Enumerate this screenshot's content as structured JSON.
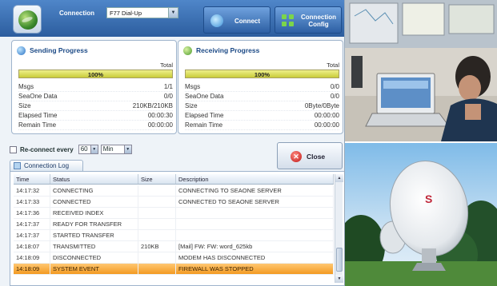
{
  "connection": {
    "label": "Connection",
    "selected": "F77 Dial-Up",
    "connect_label": "Connect",
    "config_label": "Connection Config"
  },
  "sending": {
    "title": "Sending Progress",
    "total_label": "Total",
    "percent": "100%",
    "fraction": 1.0,
    "rows": [
      {
        "label": "Msgs",
        "value": "1/1"
      },
      {
        "label": "SeaOne Data",
        "value": "0/0"
      },
      {
        "label": "Size",
        "value": "210KB/210KB"
      },
      {
        "label": "Elapsed Time",
        "value": "00:00:30"
      },
      {
        "label": "Remain Time",
        "value": "00:00:00"
      }
    ]
  },
  "receiving": {
    "title": "Receiving Progress",
    "total_label": "Total",
    "percent": "100%",
    "fraction": 1.0,
    "rows": [
      {
        "label": "Msgs",
        "value": "0/0"
      },
      {
        "label": "SeaOne Data",
        "value": "0/0"
      },
      {
        "label": "Size",
        "value": "0Byte/0Byte"
      },
      {
        "label": "Elapsed Time",
        "value": "00:00:00"
      },
      {
        "label": "Remain Time",
        "value": "00:00:00"
      }
    ]
  },
  "reconnect": {
    "label": "Re-connect every",
    "interval": "60",
    "unit": "Min"
  },
  "close_label": "Close",
  "log": {
    "tab_label": "Connection Log",
    "columns": [
      "Time",
      "Status",
      "Size",
      "Description"
    ],
    "rows": [
      {
        "time": "14:17:32",
        "status": "CONNECTING",
        "size": "",
        "description": "CONNECTING TO SEAONE SERVER"
      },
      {
        "time": "14:17:33",
        "status": "CONNECTED",
        "size": "",
        "description": "CONNECTED TO SEAONE SERVER"
      },
      {
        "time": "14:17:36",
        "status": "RECEIVED INDEX",
        "size": "",
        "description": ""
      },
      {
        "time": "14:17:37",
        "status": "READY FOR TRANSFER",
        "size": "",
        "description": ""
      },
      {
        "time": "14:17:37",
        "status": "STARTED TRANSFER",
        "size": "",
        "description": ""
      },
      {
        "time": "14:18:07",
        "status": "TRANSMITTED",
        "size": "210KB",
        "description": "[Mail] FW: FW: word_625kb"
      },
      {
        "time": "14:18:09",
        "status": "DISCONNECTED",
        "size": "",
        "description": "MODEM HAS DISCONNECTED"
      },
      {
        "time": "14:18:09",
        "status": "SYSTEM EVENT",
        "size": "",
        "description": "FIREWALL WAS STOPPED"
      }
    ],
    "selected_row": 7
  },
  "photos": {
    "operator_photo": "operator-at-laptop",
    "antenna_photo": "satellite-dish-antenna"
  },
  "colors": {
    "header_blue": "#2c5d9e",
    "progress_yellow": "#e6e86a",
    "selected_orange": "#f39a22"
  }
}
